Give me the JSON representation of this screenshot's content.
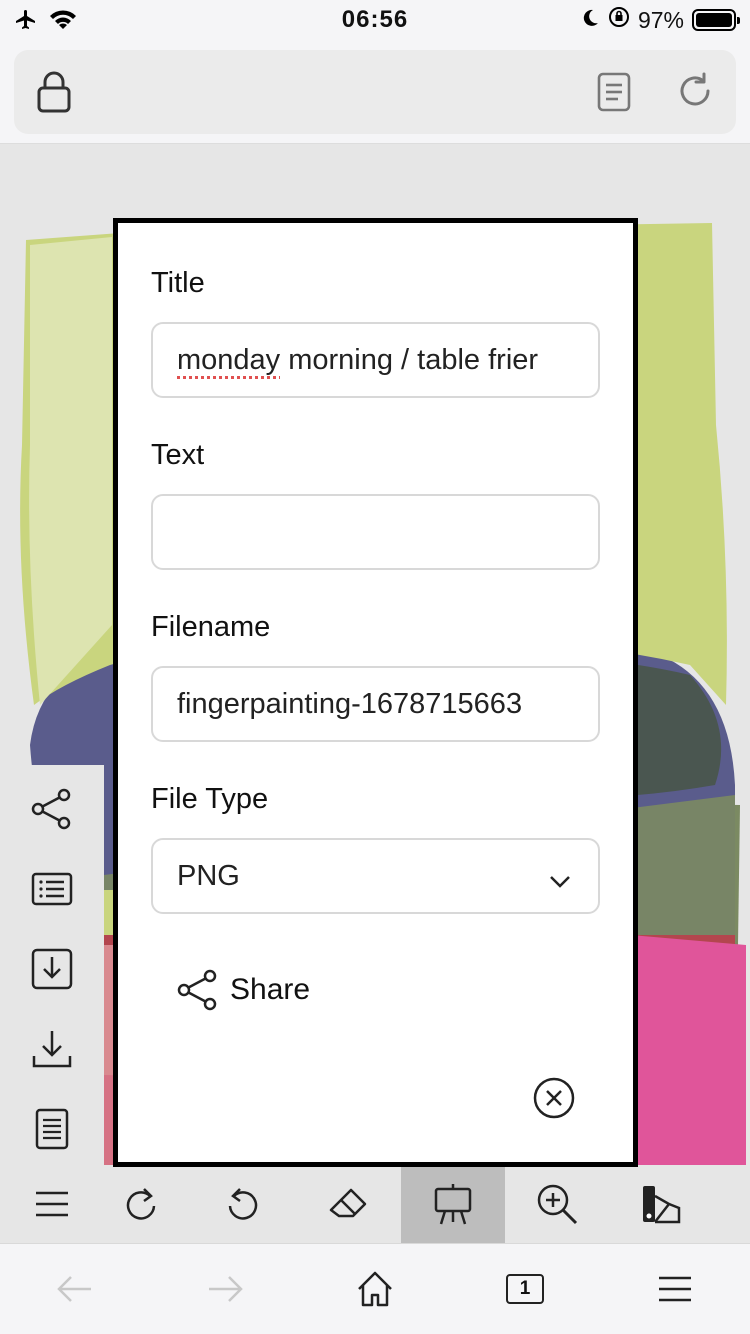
{
  "status_bar": {
    "time": "06:56",
    "battery": "97%",
    "icons": [
      "airplane-icon",
      "wifi-icon",
      "moon-icon",
      "orientation-lock-icon",
      "battery-icon"
    ]
  },
  "browser": {
    "url_icons": [
      "lock-icon",
      "reader-icon",
      "reload-icon"
    ],
    "tab_count": "1",
    "bottom_icons": [
      "back-arrow-icon",
      "forward-arrow-icon",
      "home-icon",
      "tabs-icon",
      "menu-icon"
    ]
  },
  "side_toolbar": {
    "icons": [
      "share-icon",
      "list-icon",
      "import-icon",
      "download-icon",
      "document-icon"
    ]
  },
  "app_toolbar": {
    "icons": [
      "menu-icon",
      "redo-icon",
      "undo-icon",
      "eraser-icon",
      "easel-icon",
      "zoom-in-icon",
      "brush-palette-icon"
    ],
    "active": "easel-icon"
  },
  "dialog": {
    "title_label": "Title",
    "title_value": "monday morning / table frier",
    "title_value_underlined": "monday",
    "title_value_rest": " morning / table frier",
    "text_label": "Text",
    "text_value": "",
    "filename_label": "Filename",
    "filename_value": "fingerpainting-1678715663",
    "filetype_label": "File Type",
    "filetype_value": "PNG",
    "filetype_options": [
      "PNG"
    ],
    "share_label": "Share"
  },
  "colors": {
    "lime": "#c9d57e",
    "lime_light": "#dde4b0",
    "indigo": "#5a5c8c",
    "slate_green": "#4a5650",
    "olive": "#7b8a62",
    "maroon": "#b3464e",
    "pink": "#e0559a"
  }
}
